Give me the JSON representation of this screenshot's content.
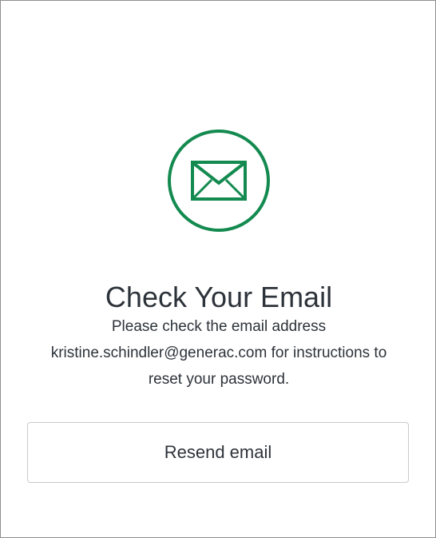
{
  "status_icon": {
    "name": "envelope-icon",
    "color": "#138a4f"
  },
  "heading": "Check Your Email",
  "message": {
    "line1": "Please check the email address",
    "line2": "kristine.schindler@generac.com for instructions to",
    "line3": "reset your password."
  },
  "resend_button_label": "Resend email"
}
